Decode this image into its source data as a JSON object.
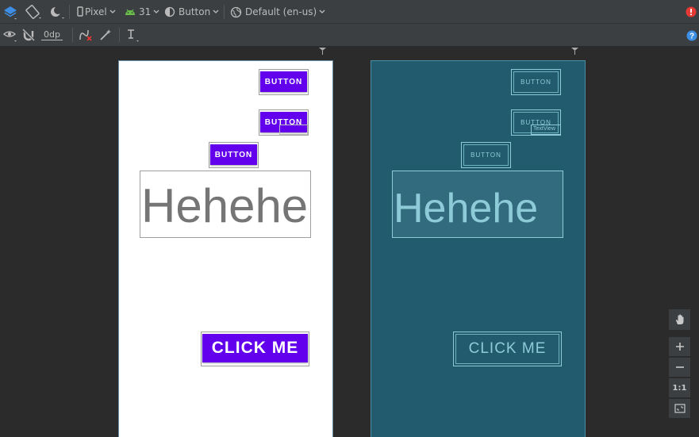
{
  "toolbar": {
    "device_label": "Pixel",
    "api_label": "31",
    "theme_label": "Button",
    "locale_label": "Default (en-us)"
  },
  "toolbar2": {
    "margin_value": "0dp"
  },
  "design": {
    "button1": "BUTTON",
    "button2": "BUTTON",
    "button3": "BUTTON",
    "textview": "Hehehe",
    "click_me": "CLICK ME"
  },
  "blueprint": {
    "button1": "BUTTON",
    "button2": "BUTTON",
    "textview_small": "TextView",
    "button3": "BUTTON",
    "textview": "Hehehe",
    "click_me": "CLICK ME"
  },
  "zoom": {
    "actual_size": "1:1"
  },
  "colors": {
    "accent_button": "#6200ee",
    "blueprint_bg": "#235b6e",
    "blueprint_line": "#8ecbd8",
    "error": "#e53935",
    "help": "#3d8fe6"
  }
}
